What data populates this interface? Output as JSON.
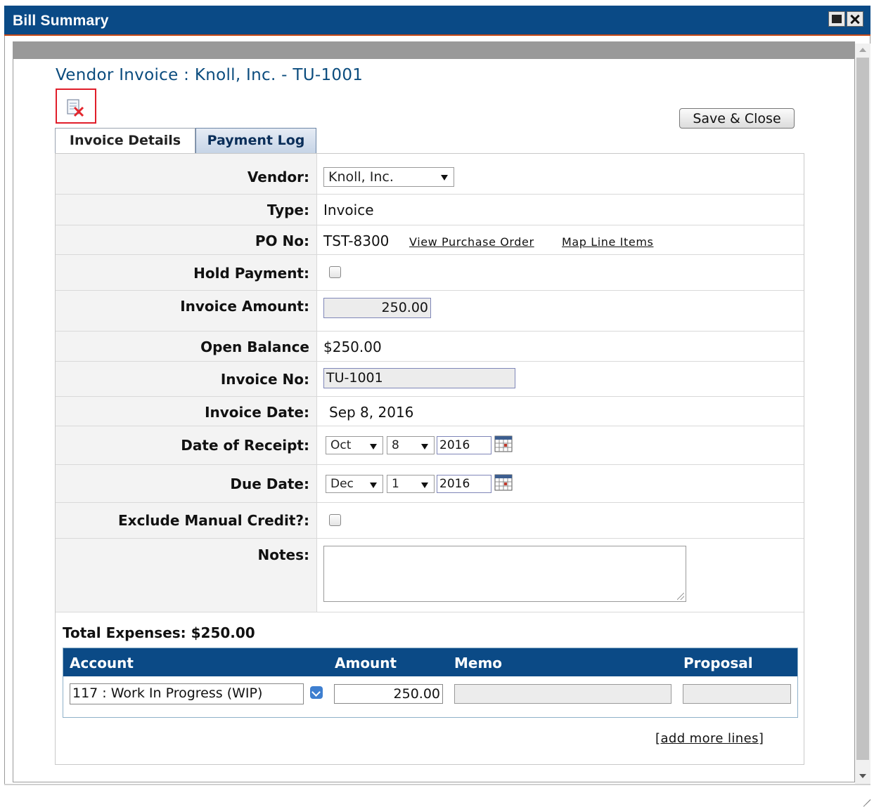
{
  "window": {
    "title": "Bill Summary"
  },
  "page": {
    "heading": "Vendor Invoice : Knoll, Inc. - TU-1001",
    "save_close_label": "Save & Close"
  },
  "tabs": [
    {
      "label": "Invoice Details",
      "active": true
    },
    {
      "label": "Payment Log",
      "active": false
    }
  ],
  "form": {
    "vendor": {
      "label": "Vendor:",
      "value": "Knoll, Inc."
    },
    "type": {
      "label": "Type:",
      "value": "Invoice"
    },
    "po_no": {
      "label": "PO No:",
      "value": "TST-8300",
      "view_po_link": "View Purchase Order",
      "map_items_link": "Map Line Items"
    },
    "hold_payment": {
      "label": "Hold Payment:",
      "checked": false
    },
    "invoice_amount": {
      "label": "Invoice Amount:",
      "value": "250.00"
    },
    "open_balance": {
      "label": "Open Balance",
      "value": "$250.00"
    },
    "invoice_no": {
      "label": "Invoice No:",
      "value": "TU-1001"
    },
    "invoice_date": {
      "label": "Invoice Date:",
      "value": "Sep 8, 2016"
    },
    "date_of_receipt": {
      "label": "Date of Receipt:",
      "month": "Oct",
      "day": "8",
      "year": "2016"
    },
    "due_date": {
      "label": "Due Date:",
      "month": "Dec",
      "day": "1",
      "year": "2016"
    },
    "exclude_manual_credit": {
      "label": "Exclude Manual Credit?:",
      "checked": false
    },
    "notes": {
      "label": "Notes:",
      "value": ""
    }
  },
  "expenses": {
    "total_label": "Total Expenses: $250.00",
    "columns": [
      "Account",
      "Amount",
      "Memo",
      "Proposal"
    ],
    "rows": [
      {
        "account": "117 : Work In Progress (WIP)",
        "amount": "250.00",
        "memo": "",
        "proposal": ""
      }
    ],
    "add_more_label": "add more lines"
  },
  "icons": {
    "delete": "delete-document-icon",
    "calendar": "calendar-icon",
    "account_dropdown": "chevron-down-icon"
  },
  "colors": {
    "titlebar": "#0a4a86",
    "heading": "#0b4c7e",
    "table_header": "#0b4a86",
    "delete_highlight": "#e01e2a"
  }
}
